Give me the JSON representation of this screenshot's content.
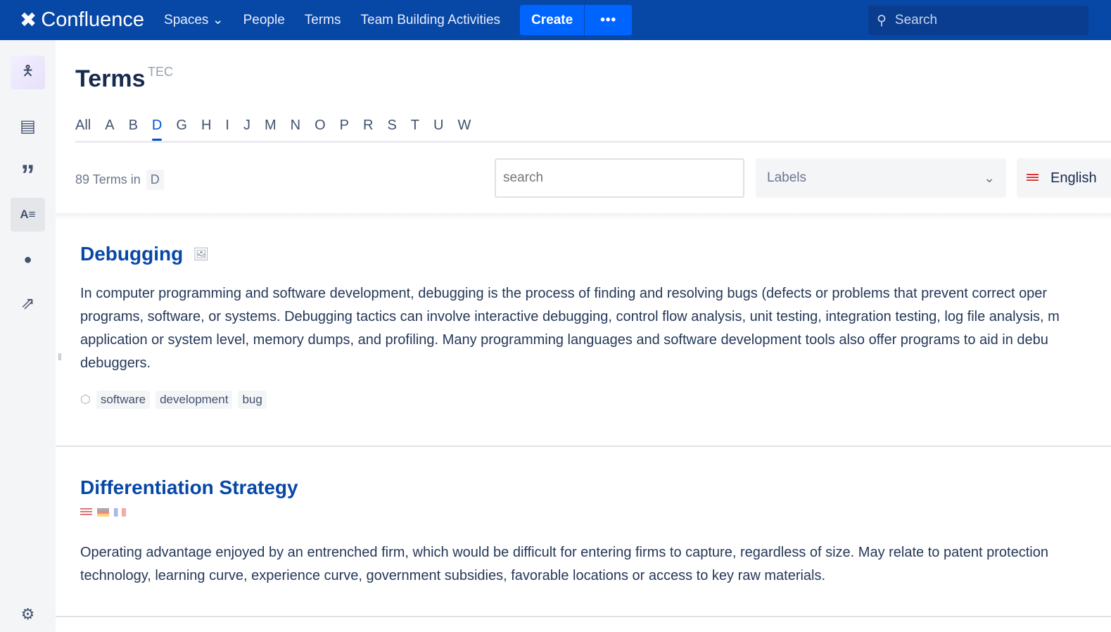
{
  "topnav": {
    "brand": "Confluence",
    "spaces": "Spaces",
    "people": "People",
    "terms": "Terms",
    "team": "Team Building Activities",
    "create": "Create",
    "more": "•••",
    "search": "Search"
  },
  "page": {
    "title": "Terms",
    "space_key": "TEC"
  },
  "alphabet": [
    "All",
    "A",
    "B",
    "D",
    "G",
    "H",
    "I",
    "J",
    "M",
    "N",
    "O",
    "P",
    "R",
    "S",
    "T",
    "U",
    "W"
  ],
  "active_letter": "D",
  "count": {
    "text": "89 Terms in",
    "letter": "D"
  },
  "filters": {
    "search_placeholder": "search",
    "labels": "Labels",
    "language": "English"
  },
  "terms": [
    {
      "title": "Debugging",
      "lines": [
        "In computer programming and software development, debugging is the process of finding and resolving bugs (defects or problems that prevent correct oper",
        "programs, software, or systems. Debugging tactics can involve interactive debugging, control flow analysis, unit testing, integration testing, log file analysis, m",
        "application or system level, memory dumps, and profiling. Many programming languages and software development tools also offer programs to aid in debu",
        "debuggers."
      ],
      "labels": [
        "software",
        "development",
        "bug"
      ]
    },
    {
      "title": "Differentiation Strategy",
      "lines": [
        "Operating advantage enjoyed by an entrenched firm, which would be difficult for entering firms to capture, regardless of size. May relate to patent protection",
        "technology, learning curve, experience curve, government subsidies, favorable locations or access to key raw materials."
      ]
    }
  ]
}
